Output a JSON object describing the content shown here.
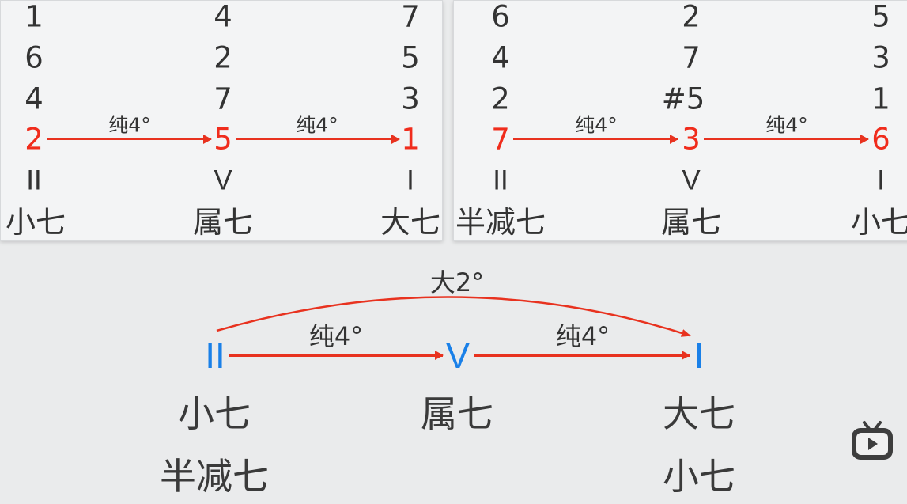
{
  "left_panel": {
    "columns": [
      {
        "notes": [
          "1",
          "6",
          "4"
        ],
        "root": "2",
        "roman": "II",
        "quality": "小七"
      },
      {
        "notes": [
          "4",
          "2",
          "7"
        ],
        "root": "5",
        "roman": "V",
        "quality": "属七"
      },
      {
        "notes": [
          "7",
          "5",
          "3"
        ],
        "root": "1",
        "roman": "I",
        "quality": "大七"
      }
    ],
    "intervals": [
      "纯4°",
      "纯4°"
    ]
  },
  "right_panel": {
    "columns": [
      {
        "notes": [
          "6",
          "4",
          "2"
        ],
        "root": "7",
        "roman": "II",
        "quality": "半减七"
      },
      {
        "notes": [
          "2",
          "7",
          "#5"
        ],
        "root": "3",
        "roman": "V",
        "quality": "属七"
      },
      {
        "notes": [
          "5",
          "3",
          "1"
        ],
        "root": "6",
        "roman": "I",
        "quality": "小七"
      }
    ],
    "intervals": [
      "纯4°",
      "纯4°"
    ]
  },
  "bottom": {
    "arc_interval": "大2°",
    "chords": [
      {
        "roman": "II",
        "qualities": [
          "小七",
          "半减七"
        ]
      },
      {
        "roman": "V",
        "qualities": [
          "属七"
        ]
      },
      {
        "roman": "I",
        "qualities": [
          "大七",
          "小七"
        ]
      }
    ],
    "intervals": [
      "纯4°",
      "纯4°"
    ]
  },
  "colors": {
    "root_red": "#f02c1c",
    "arrow_red": "#e8321f",
    "roman_blue": "#1a80e8",
    "text_dark": "#333333",
    "background": "#eaebec",
    "panel": "#f3f4f5"
  },
  "icons": {
    "watermark": "bilibili-tv-icon"
  }
}
